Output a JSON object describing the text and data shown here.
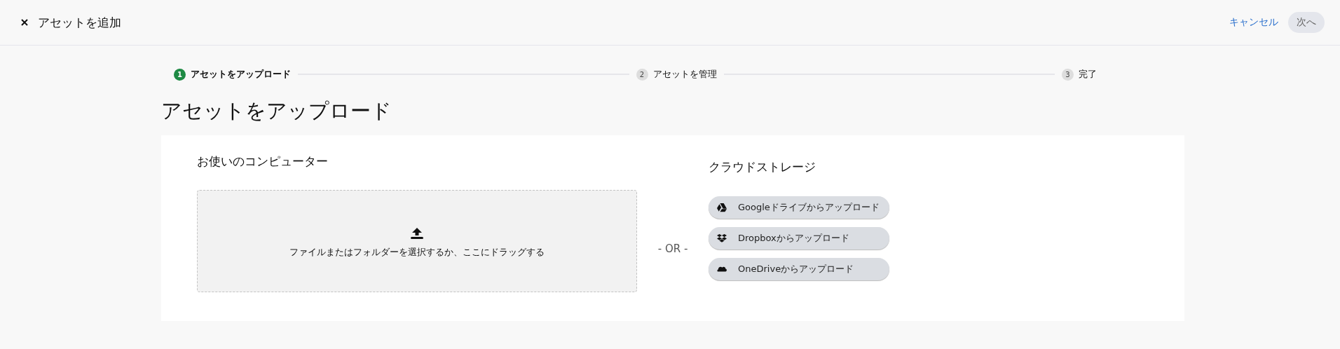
{
  "header": {
    "title": "アセットを追加",
    "cancel": "キャンセル",
    "next": {
      "label": "次へ",
      "disabled": true
    }
  },
  "steps": [
    {
      "number": "1",
      "label": "アセットをアップロード",
      "selected": true
    },
    {
      "number": "2",
      "label": "アセットを管理",
      "selected": false
    },
    {
      "number": "3",
      "label": "完了",
      "selected": false
    }
  ],
  "heading": "アセットをアップロード",
  "computer": {
    "title": "お使いのコンピューター",
    "dropzone": "ファイルまたはフォルダーを選択するか、ここにドラッグする"
  },
  "separator": "- OR -",
  "cloud": {
    "title": "クラウドストレージ",
    "buttons": [
      {
        "kind": "drive",
        "label": "Googleドライブからアップロード"
      },
      {
        "kind": "dropbox",
        "label": "Dropboxからアップロード"
      },
      {
        "kind": "onedrive",
        "label": "OneDriveからアップロード"
      }
    ]
  }
}
